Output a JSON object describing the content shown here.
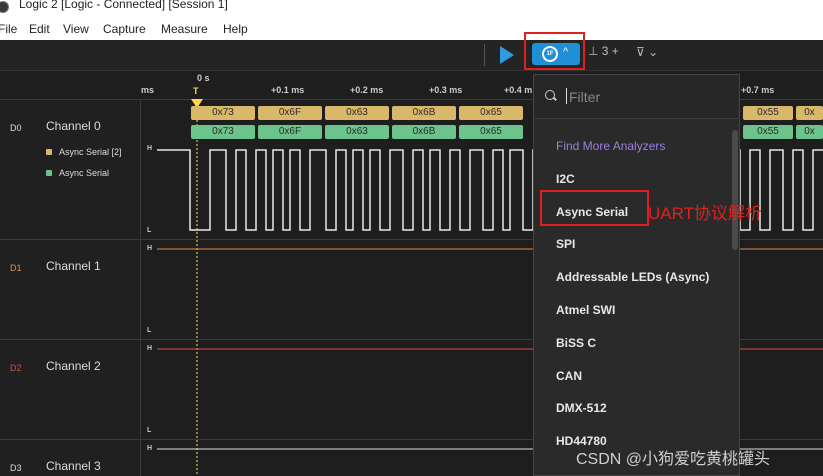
{
  "window": {
    "title": "Logic 2 [Logic - Connected] [Session 1]"
  },
  "menu": {
    "items": [
      "File",
      "Edit",
      "View",
      "Capture",
      "Measure",
      "Help"
    ]
  },
  "toolbar": {
    "measure_label": "3 +",
    "accent": "#1f8fd6"
  },
  "timeline": {
    "unit_left": "ms",
    "zero_label": "0 s",
    "trigger_label": "T",
    "ticks": [
      "+0.1 ms",
      "+0.2 ms",
      "+0.3 ms",
      "+0.4 m",
      "+0.7 ms"
    ]
  },
  "channels": [
    {
      "id": "D0",
      "name": "Channel 0",
      "id_color": "#dddddd"
    },
    {
      "id": "D1",
      "name": "Channel 1",
      "id_color": "#e08a4a"
    },
    {
      "id": "D2",
      "name": "Channel 2",
      "id_color": "#e04848"
    },
    {
      "id": "D3",
      "name": "Channel 3",
      "id_color": "#dddddd"
    }
  ],
  "analyzers": [
    {
      "label": "Async Serial [2]",
      "color": "#d9b86a"
    },
    {
      "label": "Async Serial",
      "color": "#6cc48c"
    }
  ],
  "level_labels": {
    "high": "H",
    "low": "L"
  },
  "decoded": {
    "row1": [
      "0x73",
      "0x6F",
      "0x63",
      "0x6B",
      "0x65",
      "0x55",
      "0x"
    ],
    "row2": [
      "0x73",
      "0x6F",
      "0x63",
      "0x6B",
      "0x65",
      "0x55",
      "0x"
    ]
  },
  "dropdown": {
    "filter_placeholder": "Filter",
    "find_more": "Find More Analyzers",
    "items": [
      "I2C",
      "Async Serial",
      "SPI",
      "Addressable LEDs (Async)",
      "Atmel SWI",
      "BiSS C",
      "CAN",
      "DMX-512",
      "HD44780"
    ]
  },
  "annotation": "UART协议解析",
  "watermark": "CSDN @小狗爱吃黄桃罐头"
}
